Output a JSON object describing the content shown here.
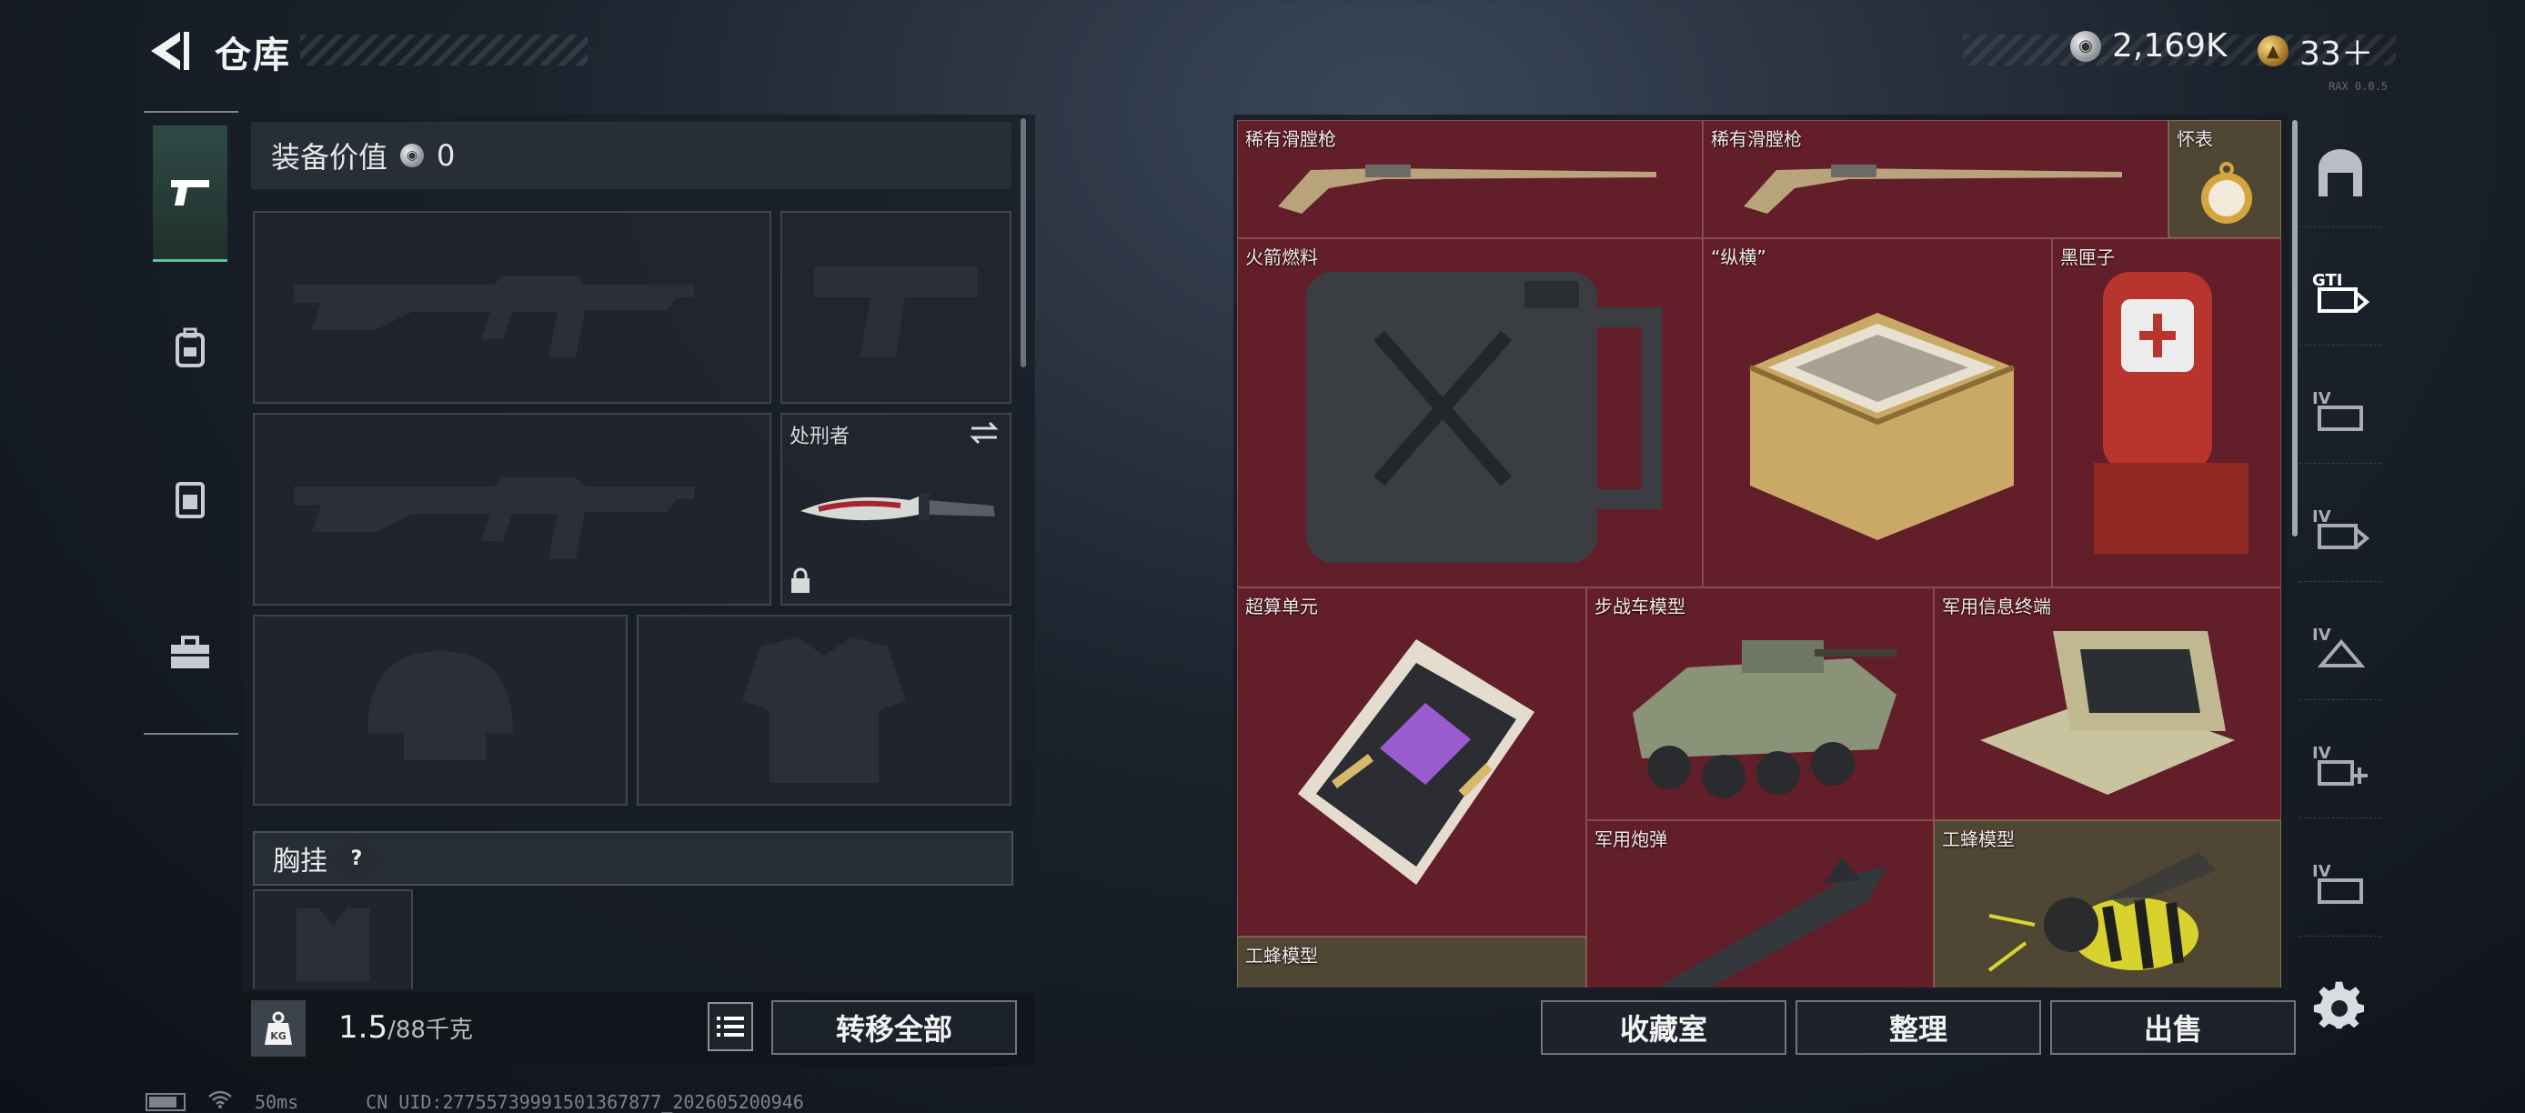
{
  "header": {
    "title": "仓库",
    "currency_silver": "2,169K",
    "currency_gold": "33＋",
    "version": "RAX 0.0.5"
  },
  "equipment": {
    "value_label": "装备价值",
    "value": "0",
    "melee_name": "处刑者",
    "chest_label": "胸挂",
    "chest_help": "?"
  },
  "bottom_left": {
    "weight": "1.5",
    "weight_max": "/88千克",
    "transfer_all": "转移全部"
  },
  "storage": {
    "items": [
      {
        "label": "稀有滑膛枪"
      },
      {
        "label": "稀有滑膛枪"
      },
      {
        "label": "怀表"
      },
      {
        "label": "火箭燃料"
      },
      {
        "label": "“纵横”"
      },
      {
        "label": "黑匣子"
      },
      {
        "label": "超算单元"
      },
      {
        "label": "步战车模型"
      },
      {
        "label": "军用信息终端"
      },
      {
        "label": "军用炮弹"
      },
      {
        "label": "工蜂模型"
      },
      {
        "label": "工蜂模型"
      }
    ],
    "buttons": {
      "collection": "收藏室",
      "sort": "整理",
      "sell": "出售"
    }
  },
  "status_bar": {
    "ping": "50ms",
    "uid": "CN UID:27755739991501367877_202605200946"
  }
}
